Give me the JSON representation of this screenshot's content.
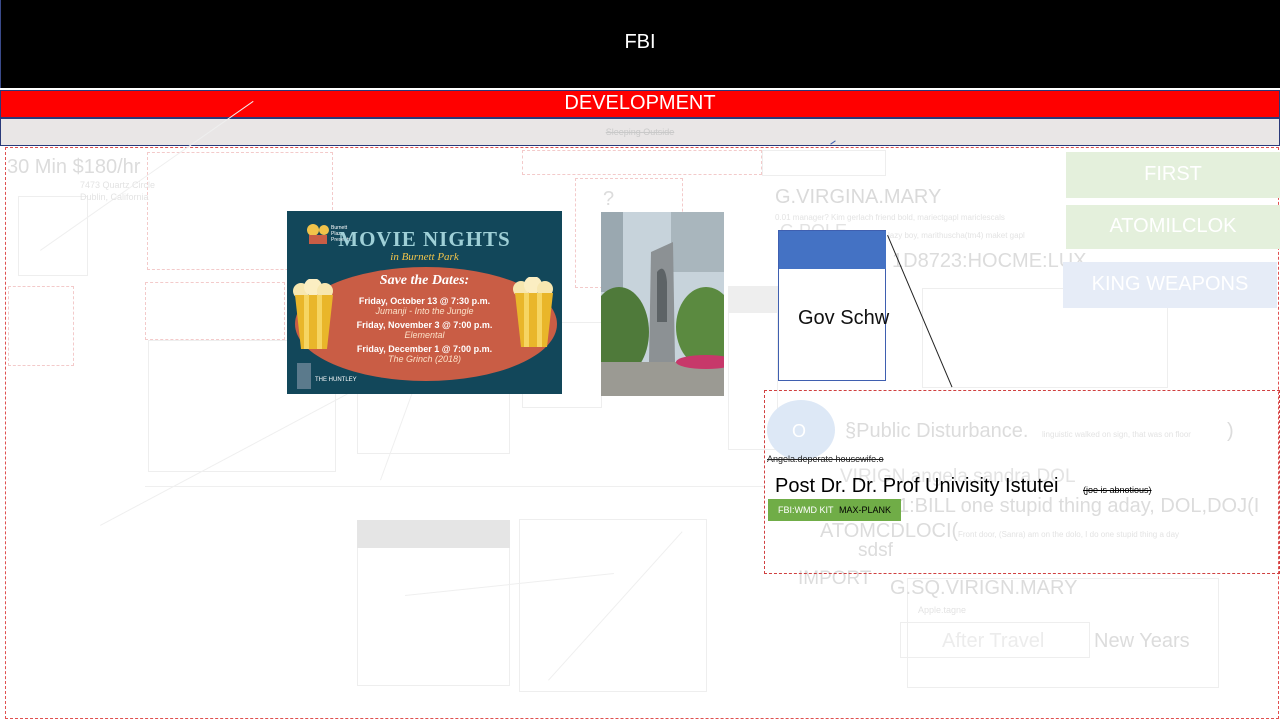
{
  "header": {
    "title": "FBI"
  },
  "banner": {
    "title": "DEVELOPMENT"
  },
  "subbar": {
    "title": "Sleeping Outside"
  },
  "background_text": {
    "rate": "30 Min $180/hr",
    "address_line1": "7473 Quartz Circle",
    "address_line2": "Dublin, California",
    "question": "?",
    "virgina": "G.VIRGINA.MARY",
    "virgina_note": "0.01 manager? Kim gerlach friend bold, mariectgapl mariclescals",
    "pole": "G.POLE",
    "pole_note": "lazy boy, marithuscha(tm4) maket gapl",
    "code": "1D8723:HOCME:LUX",
    "public_disturbance": "§Public Disturbance.",
    "public_note": "linguistic walked on sign, that was on floor",
    "virign_angela": "VIRIGN.angela.sandra.DOL",
    "bill": "1:BILL one stupid thing aday, DOL,DOJ(I",
    "atom": "ATOMCDLOCI(",
    "atom_note": "Front door, (Sanra) am on the dolo, I do one stupid thing a day",
    "sdsf": "sdsf",
    "import": "IMPORT",
    "sq_virign": "G.SQ.VIRIGN.MARY",
    "apple": "Apple.tagne",
    "new_years": "New Years",
    "after_travel": "After Travel"
  },
  "poster": {
    "title": "MOVIE NIGHTS",
    "subtitle": "in Burnett Park",
    "save": "Save the Dates:",
    "line1": "Friday, October 13 @ 7:30 p.m.",
    "movie1": "Jumanji - Into the Jungle",
    "line2": "Friday, November 3 @ 7:00 p.m.",
    "movie2": "Elemental",
    "line3": "Friday, December 1 @ 7:00 p.m.",
    "movie3": "The Grinch (2018)",
    "brand": "THE HUNTLEY",
    "badge": "Burnett Plaza Presents..."
  },
  "gov_card": {
    "name": "Gov Schw"
  },
  "panel": {
    "avatar_letter": "O",
    "angela": "Angela.deperate housewife.o",
    "title": "Post Dr. Dr. Prof Univisity Istutei",
    "note": "(joe is abnotious)",
    "kit_prefix": "FBI:WMD KIT",
    "kit_suffix": "MAX-PLANK"
  },
  "side_buttons": {
    "first": "FIRST",
    "atom": "ATOMILCLOK",
    "king": "KING WEAPONS"
  },
  "colors": {
    "header_bg": "#000000",
    "banner_bg": "#ff0000",
    "card_blue": "#4472c4",
    "kit_green": "#70ad47"
  }
}
